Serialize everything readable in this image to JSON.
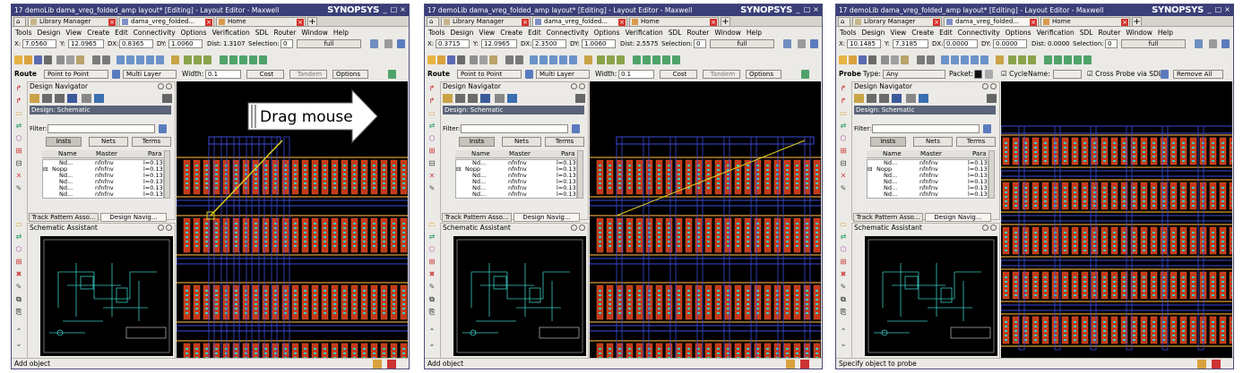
{
  "panels": [
    {
      "title": "17 demoLib dama_vreg_folded_amp layout* [Editing] - Layout Editor - Maxwell",
      "brand": "SYNOPSYS",
      "tabs": [
        "Library Manager",
        "dama_vreg_folded...",
        "Home"
      ],
      "menu": [
        "Tools",
        "Design",
        "View",
        "Create",
        "Edit",
        "Connectivity",
        "Options",
        "Verification",
        "SDL",
        "Router",
        "Window",
        "Help"
      ],
      "coords": {
        "x_label": "X:",
        "x": "7.0560",
        "y_label": "Y:",
        "y": "12.0965",
        "dx_label": "DX:",
        "dx": "0.8365",
        "dy_label": "DY:",
        "dy": "1.0060",
        "dist_label": "Dist:",
        "dist": "1.3107",
        "sel_label": "Selection:",
        "sel": "0",
        "full": "full"
      },
      "mode": {
        "name": "Route",
        "f1": "Point to Point",
        "f2": "Multi Layer",
        "width_label": "Width:",
        "width": "0.1",
        "cost": "Cost",
        "tandem": "Tandem",
        "options": "Options"
      },
      "nav": {
        "title": "Design Navigator",
        "design_label": "Design:",
        "design_value": "Schematic",
        "filter_label": "Filter:",
        "btn_insts": "Insts",
        "btn_nets": "Nets",
        "btn_terms": "Terms",
        "col_name": "Name",
        "col_master": "Master",
        "col_params": "Para"
      },
      "rows": [
        {
          "name": "Nd...",
          "master": "nfnfnv",
          "param": "l=0.13"
        },
        {
          "name": "Nopp",
          "master": "nfnfnv",
          "param": "l=0.13"
        },
        {
          "name": "Nd...",
          "master": "nfnfnv",
          "param": "l=0.13"
        },
        {
          "name": "Nd...",
          "master": "nfnfnv",
          "param": "l=0.13"
        },
        {
          "name": "Nd...",
          "master": "nfnfnv",
          "param": "l=0.13"
        },
        {
          "name": "Nd...",
          "master": "nfnfnv",
          "param": "l=0.13"
        }
      ],
      "navtabs": [
        "Track Pattern Asso...",
        "Design Navig..."
      ],
      "assistant": "Schematic Assistant",
      "status": "Add object",
      "drag_label": "Drag mouse"
    },
    {
      "title": "17 demoLib dama_vreg_folded_amp layout* [Editing] - Layout Editor - Maxwell",
      "brand": "SYNOPSYS",
      "tabs": [
        "Library Manager",
        "dama_vreg_folded...",
        "Home"
      ],
      "menu": [
        "Tools",
        "Design",
        "View",
        "Create",
        "Edit",
        "Connectivity",
        "Options",
        "Verification",
        "SDL",
        "Router",
        "Window",
        "Help"
      ],
      "coords": {
        "x_label": "X:",
        "x": "0.3715",
        "y_label": "Y:",
        "y": "12.0965",
        "dx_label": "DX:",
        "dx": "2.3500",
        "dy_label": "DY:",
        "dy": "1.0060",
        "dist_label": "Dist:",
        "dist": "2.5575",
        "sel_label": "Selection:",
        "sel": "0",
        "full": "full"
      },
      "mode": {
        "name": "Route",
        "f1": "Point to Point",
        "f2": "Multi Layer",
        "width_label": "Width:",
        "width": "0.1",
        "cost": "Cost",
        "tandem": "Tandem",
        "options": "Options"
      },
      "nav": {
        "title": "Design Navigator",
        "design_label": "Design:",
        "design_value": "Schematic",
        "filter_label": "Filter:",
        "btn_insts": "Insts",
        "btn_nets": "Nets",
        "btn_terms": "Terms",
        "col_name": "Name",
        "col_master": "Master",
        "col_params": "Para"
      },
      "rows": [
        {
          "name": "Nd...",
          "master": "nfnfnv",
          "param": "l=0.13"
        },
        {
          "name": "Nopp",
          "master": "nfnfnv",
          "param": "l=0.13"
        },
        {
          "name": "Nd...",
          "master": "nfnfnv",
          "param": "l=0.13"
        },
        {
          "name": "Nd...",
          "master": "nfnfnv",
          "param": "l=0.13"
        },
        {
          "name": "Nd...",
          "master": "nfnfnv",
          "param": "l=0.13"
        },
        {
          "name": "Nd...",
          "master": "nfnfnv",
          "param": "l=0.13"
        }
      ],
      "navtabs": [
        "Track Pattern Asso...",
        "Design Navig..."
      ],
      "assistant": "Schematic Assistant",
      "status": "Add object"
    },
    {
      "title": "17 demoLib dama_vreg_folded_amp layout* [Editing] - Layout Editor - Maxwell",
      "brand": "SYNOPSYS",
      "tabs": [
        "Library Manager",
        "dama_vreg_folded...",
        "Home"
      ],
      "menu": [
        "Tools",
        "Design",
        "View",
        "Create",
        "Edit",
        "Connectivity",
        "Options",
        "Verification",
        "SDL",
        "Router",
        "Window",
        "Help"
      ],
      "coords": {
        "x_label": "X:",
        "x": "10.1485",
        "y_label": "Y:",
        "y": "7.3185",
        "dx_label": "DX:",
        "dx": "0.0000",
        "dy_label": "DY:",
        "dy": "0.0000",
        "dist_label": "Dist:",
        "dist": "0.0000",
        "sel_label": "Selection:",
        "sel": "0",
        "full": "full"
      },
      "mode": {
        "name": "Probe",
        "type_label": "Type:",
        "type": "Any",
        "packet_label": "Packet:",
        "cycle": "Cycle",
        "name_label": "Name:",
        "cross": "Cross Probe via SDL",
        "remove": "Remove All"
      },
      "nav": {
        "title": "Design Navigator",
        "design_label": "Design:",
        "design_value": "Schematic",
        "filter_label": "Filter:",
        "btn_insts": "Insts",
        "btn_nets": "Nets",
        "btn_terms": "Terms",
        "col_name": "Name",
        "col_master": "Master",
        "col_params": "Para"
      },
      "rows": [
        {
          "name": "Nd...",
          "master": "nfnfnv",
          "param": "l=0.13"
        },
        {
          "name": "Nopp",
          "master": "nfnfnv",
          "param": "l=0.13"
        },
        {
          "name": "Nd...",
          "master": "nfnfnv",
          "param": "l=0.13"
        },
        {
          "name": "Nd...",
          "master": "nfnfnv",
          "param": "l=0.13"
        },
        {
          "name": "Nd...",
          "master": "nfnfnv",
          "param": "l=0.13"
        },
        {
          "name": "Nd...",
          "master": "nfnfnv",
          "param": "l=0.13"
        }
      ],
      "navtabs": [
        "Track Pattern Asso...",
        "Design Navig..."
      ],
      "assistant": "Schematic Assistant",
      "status": "Specify object to probe"
    }
  ],
  "colors": {
    "titlebar": "#3a3f78",
    "canvas": "#000000",
    "device_fill": "#c23a1a",
    "device_outline": "#e3a43a",
    "contact": "#35d0c8",
    "route": "#3b4ad8",
    "drag": "#e0d020"
  }
}
